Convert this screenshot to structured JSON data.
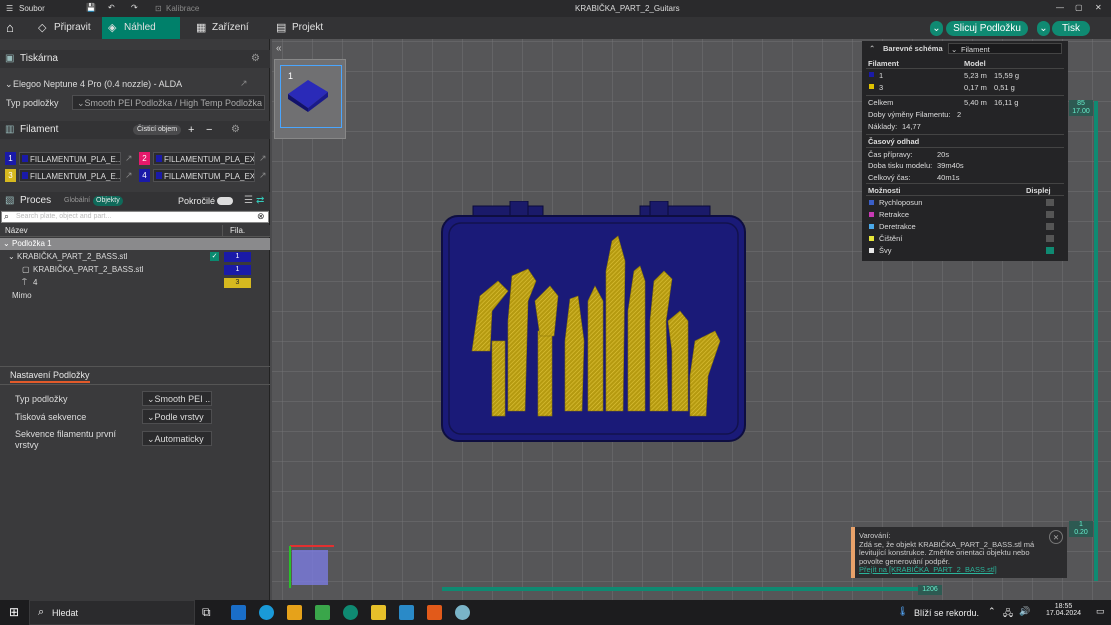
{
  "titlebar": {
    "menu_label": "Soubor",
    "calibration_label": "Kalibrace",
    "window_title": "KRABIČKA_PART_2_Guitars"
  },
  "toolbar": {
    "tabs": [
      {
        "label": "Připravit"
      },
      {
        "label": "Náhled"
      },
      {
        "label": "Zařízení"
      },
      {
        "label": "Projekt"
      }
    ],
    "slice_label": "Slicuj Podložku",
    "print_label": "Tisk"
  },
  "printer": {
    "section_title": "Tiskárna",
    "name": "Elegoo Neptune 4 Pro (0.4 nozzle) - ALDA",
    "plate_type_label": "Typ podložky",
    "plate_type_value": "Smooth PEI Podložka / High Temp Podložka"
  },
  "filament": {
    "section_title": "Filament",
    "clean_volume_label": "Čisticí objem",
    "items": [
      {
        "num": "1",
        "name": "FILLAMENTUM_PLA_E...",
        "num_color": "#1a1aa8",
        "swatch": "#1a1aa8"
      },
      {
        "num": "2",
        "name": "FILLAMENTUM_PLA_EX...",
        "num_color": "#e6196b",
        "swatch": "#1a1aa8"
      },
      {
        "num": "3",
        "name": "FILLAMENTUM_PLA_E...",
        "num_color": "#d6b91f",
        "swatch": "#1a1aa8"
      },
      {
        "num": "4",
        "name": "FILLAMENTUM_PLA_EX...",
        "num_color": "#1a1aa8",
        "swatch": "#1a1aa8"
      }
    ]
  },
  "process": {
    "section_title": "Proces",
    "global_label": "Globální",
    "objects_label": "Objekty",
    "advanced_label": "Pokročilé",
    "search_placeholder": "Search plate, object and part...",
    "col_name": "Název",
    "col_fila": "Fila."
  },
  "tree": {
    "plate": "Podložka 1",
    "object": "KRABIČKA_PART_2_BASS.stl",
    "object_fila": "1",
    "part": "KRABIČKA_PART_2_BASS.stl",
    "part_fila": "1",
    "modifier": "4",
    "modifier_fila": "3",
    "outside": "Mimo"
  },
  "plate_settings": {
    "tab_label": "Nastavení Podložky",
    "rows": [
      {
        "label": "Typ podložky",
        "value": "Smooth PEI ..."
      },
      {
        "label": "Tisková sekvence",
        "value": "Podle vrstvy"
      },
      {
        "label": "Sekvence filamentu první vrstvy",
        "value": "Automaticky"
      }
    ]
  },
  "canvas": {
    "plate_number": "1",
    "layer_top_max": "85",
    "layer_top_height": "17.00",
    "layer_bottom_num": "1",
    "layer_bottom_height": "0.20",
    "move_slider_value": "1206"
  },
  "stats": {
    "color_scheme_label": "Barevné schéma",
    "color_scheme_value": "Filament",
    "col_filament": "Filament",
    "col_model": "Model",
    "rows": [
      {
        "id": "1",
        "color": "#1a1aa8",
        "length": "5,23 m",
        "weight": "15,59 g"
      },
      {
        "id": "3",
        "color": "#e0c200",
        "length": "0,17 m",
        "weight": "0,51 g"
      }
    ],
    "total_label": "Celkem",
    "total_length": "5,40 m",
    "total_weight": "16,11 g",
    "changes_label": "Doby výměny Filamentu:",
    "changes_value": "2",
    "cost_label": "Náklady:",
    "cost_value": "14,77",
    "time_section": "Časový odhad",
    "prep_label": "Čas přípravy:",
    "prep_value": "20s",
    "model_label": "Doba tisku modelu:",
    "model_value": "39m40s",
    "total_time_label": "Celkový čas:",
    "total_time_value": "40m1s",
    "options_label": "Možnosti",
    "display_label": "Displej",
    "options": [
      {
        "label": "Rychloposun",
        "color": "#3a5fc8"
      },
      {
        "label": "Retrakce",
        "color": "#c83ab4"
      },
      {
        "label": "Deretrakce",
        "color": "#4aa8e8"
      },
      {
        "label": "Čištění",
        "color": "#e8e83a"
      },
      {
        "label": "Švy",
        "color": "#e8e8e8"
      }
    ]
  },
  "warning": {
    "title": "Varování:",
    "line1": "Zdá se, že objekt KRABIČKA_PART_2_BASS.stl má",
    "line2": "levitující konstrukce. Změňte orientaci objektu nebo",
    "line3": "povolte generování podpěr.",
    "link": "Přejít na [KRABIČKA_PART_2_BASS.stl]"
  },
  "taskbar": {
    "search_label": "Hledat",
    "weather_label": "Blíží se rekordu.",
    "time": "18:55",
    "date": "17.04.2024"
  }
}
